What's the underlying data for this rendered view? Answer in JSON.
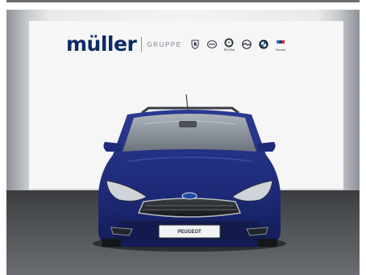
{
  "banner": {
    "logo_text": "müller",
    "subtitle": "GRUPPE",
    "brands": [
      {
        "name": "Peugeot",
        "icon": "peugeot-lion-icon",
        "label": ""
      },
      {
        "name": "Mazda",
        "icon": "mazda-icon",
        "label": ""
      },
      {
        "name": "Škoda",
        "icon": "skoda-icon",
        "label": "ŠKODA"
      },
      {
        "name": "Opel",
        "icon": "opel-icon",
        "label": ""
      },
      {
        "name": "BMW",
        "icon": "bmw-roundel-icon",
        "label": ""
      },
      {
        "name": "BMW Service",
        "icon": "bmw-m-service-icon",
        "label": "Service"
      }
    ]
  },
  "car": {
    "badge_icon": "ford-oval-icon",
    "plate_text": "PEUGEOT",
    "body_color": "#1d2a78"
  },
  "colors": {
    "brand_navy": "#0d2b66",
    "wall": "#f3f3f3",
    "floor": "#4d5053"
  }
}
